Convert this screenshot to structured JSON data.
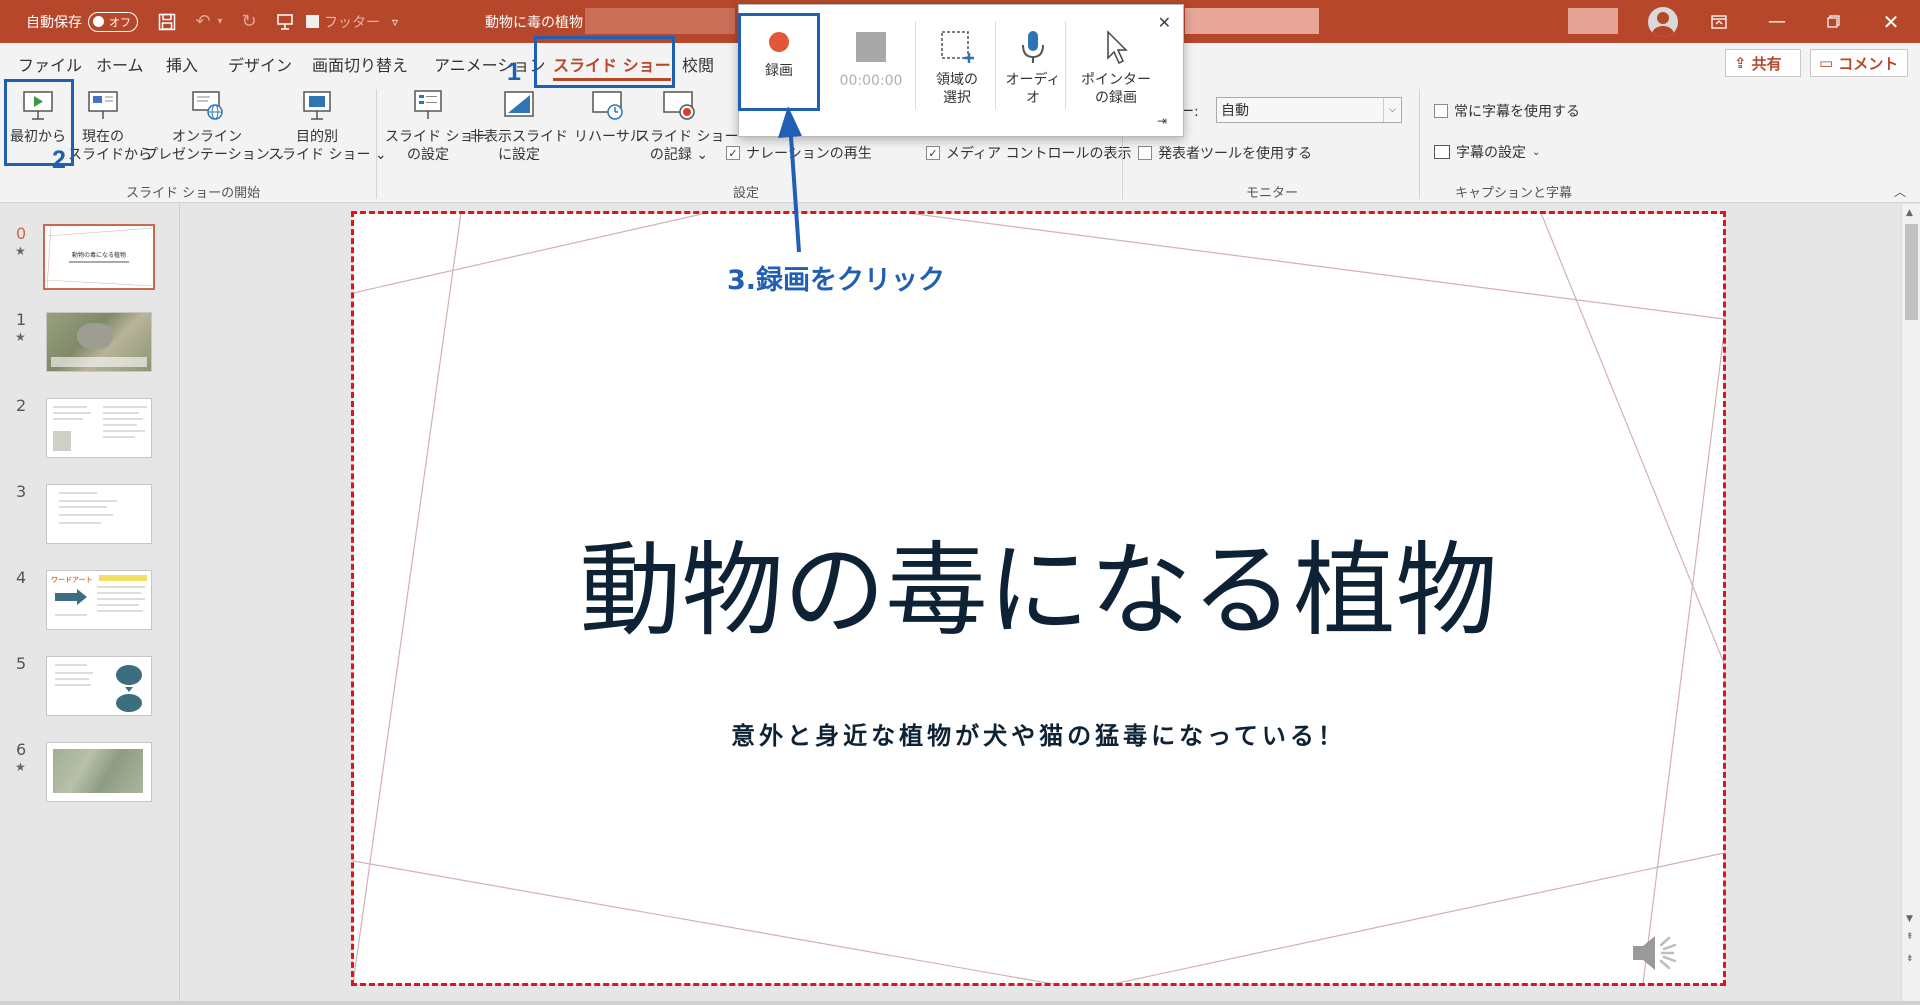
{
  "titlebar": {
    "autosave_label": "自動保存",
    "autosave_state": "オフ",
    "footer_label": "フッター",
    "document_title": "動物に毒の植物"
  },
  "ribbon_tabs": [
    "ファイル",
    "ホーム",
    "挿入",
    "デザイン",
    "画面切り替え",
    "アニメーション",
    "スライド ショー",
    "校閲"
  ],
  "share_label": "共有",
  "comment_label": "コメント",
  "groups": {
    "start": {
      "label": "スライド ショーの開始",
      "from_beginning": "最初から",
      "from_current": [
        "現在の",
        "スライドから"
      ],
      "online": [
        "オンライン",
        "プレゼンテーション"
      ],
      "custom": [
        "目的別",
        "スライド ショー"
      ]
    },
    "setup": {
      "label": "設定",
      "setup_show": [
        "スライド ショー",
        "の設定"
      ],
      "hide_slide": [
        "非表示スライド",
        "に設定"
      ],
      "rehearse": "リハーサル",
      "record": [
        "スライド ショー",
        "の記録"
      ],
      "play_narration": "ナレーションの再生",
      "show_media_controls": "メディア コントロールの表示"
    },
    "monitor": {
      "label": "モニター",
      "monitor_prefix": "ター:",
      "monitor_value": "自動",
      "presenter_view": "発表者ツールを使用する"
    },
    "captions": {
      "label": "キャプションと字幕",
      "always_subtitles": "常に字幕を使用する",
      "subtitle_settings": "字幕の設定"
    }
  },
  "recorder": {
    "record_label": "録画",
    "timer": "00:00:00",
    "select_area": [
      "領域の",
      "選択"
    ],
    "audio": [
      "オーディ",
      "オ"
    ],
    "record_pointer": [
      "ポインター",
      "の録画"
    ]
  },
  "annotations": {
    "step1": "1",
    "step2": "2",
    "step3": "3.録画をクリック"
  },
  "thumbnails": [
    {
      "num": "0",
      "star": "★",
      "title": "動物の毒になる植物"
    },
    {
      "num": "1",
      "star": "★"
    },
    {
      "num": "2",
      "star": ""
    },
    {
      "num": "3",
      "star": ""
    },
    {
      "num": "4",
      "star": "",
      "label": "ワードアート"
    },
    {
      "num": "5",
      "star": ""
    },
    {
      "num": "6",
      "star": "★"
    }
  ],
  "slide": {
    "title": "動物の毒になる植物",
    "subtitle": "意外と身近な植物が犬や猫の猛毒になっている！"
  },
  "colors": {
    "accent": "#b7472a",
    "annotation_blue": "#1f5fb4",
    "dashed_red": "#e0151b",
    "slide_text": "#0e2235"
  }
}
